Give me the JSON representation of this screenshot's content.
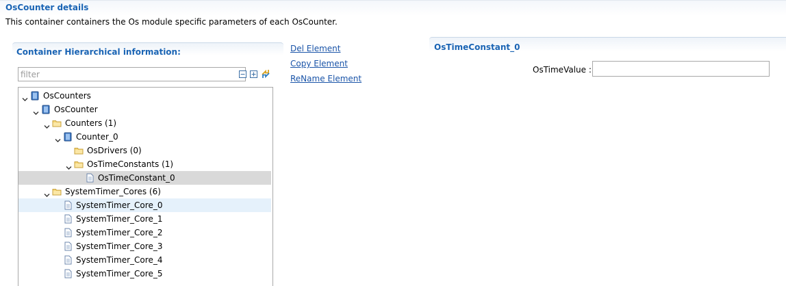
{
  "page": {
    "title": "OsCounter details",
    "description": "This container containers the Os module specific parameters of each OsCounter."
  },
  "hierarchy": {
    "title": "Container Hierarchical information:",
    "filter_placeholder": "filter",
    "tree": [
      {
        "label": "OsCounters",
        "icon": "container-icon",
        "expanded": true
      },
      {
        "label": "OsCounter",
        "icon": "container-icon",
        "expanded": true
      },
      {
        "label": "Counters (1)",
        "icon": "folder-icon",
        "expanded": true
      },
      {
        "label": "Counter_0",
        "icon": "container-icon",
        "expanded": true
      },
      {
        "label": "OsDrivers (0)",
        "icon": "folder-icon"
      },
      {
        "label": "OsTimeConstants (1)",
        "icon": "folder-icon",
        "expanded": true
      },
      {
        "label": "OsTimeConstant_0",
        "icon": "document-icon",
        "selected": true
      },
      {
        "label": "SystemTimer_Cores (6)",
        "icon": "folder-icon",
        "expanded": true
      },
      {
        "label": "SystemTimer_Core_0",
        "icon": "document-icon",
        "hovered": true
      },
      {
        "label": "SystemTimer_Core_1",
        "icon": "document-icon"
      },
      {
        "label": "SystemTimer_Core_2",
        "icon": "document-icon"
      },
      {
        "label": "SystemTimer_Core_3",
        "icon": "document-icon"
      },
      {
        "label": "SystemTimer_Core_4",
        "icon": "document-icon"
      },
      {
        "label": "SystemTimer_Core_5",
        "icon": "document-icon"
      }
    ]
  },
  "actions": {
    "del": "Del Element",
    "copy": "Copy Element",
    "rename": "ReName Element"
  },
  "detail": {
    "title": "OsTimeConstant_0",
    "field_label": "OsTimeValue :",
    "field_value": ""
  },
  "colors": {
    "title_blue": "#1a64b4",
    "link_blue": "#1a54a8",
    "selected_row": "#d9d9d9",
    "hover_row": "#e5f1fb"
  }
}
